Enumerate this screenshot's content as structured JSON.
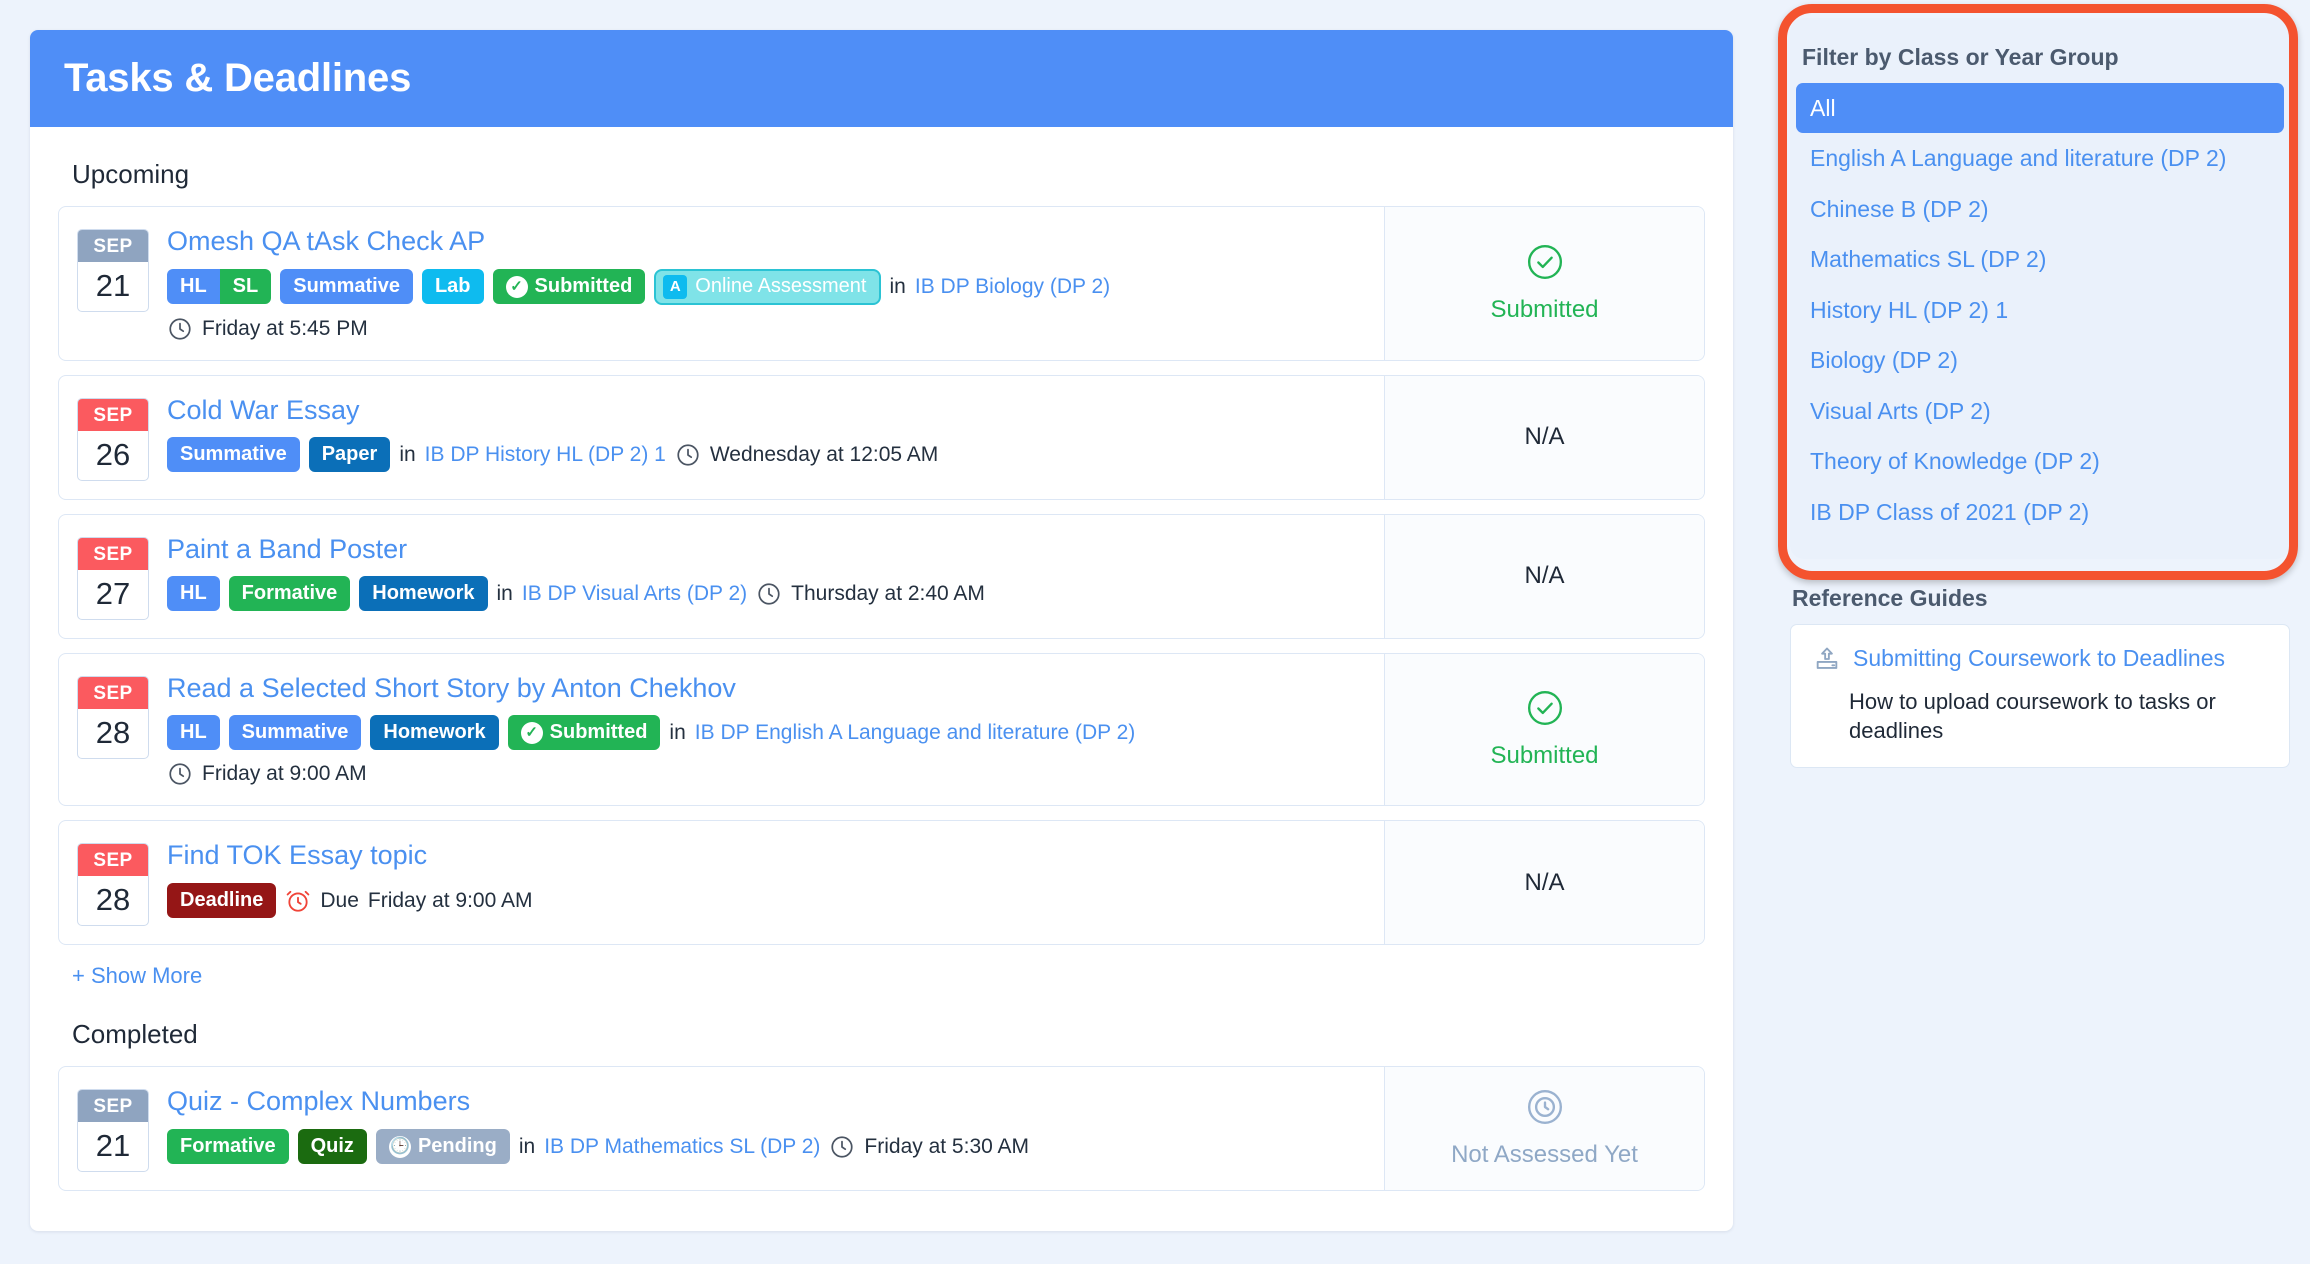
{
  "header": {
    "title": "Tasks & Deadlines"
  },
  "sections": {
    "upcoming_label": "Upcoming",
    "completed_label": "Completed",
    "show_more_label": "+ Show More"
  },
  "labels": {
    "in": "in",
    "due": "Due"
  },
  "upcoming": [
    {
      "month": "SEP",
      "day": "21",
      "date_state": "past",
      "title": "Omesh QA tAsk Check AP",
      "badges": [
        {
          "type": "split",
          "left": "HL",
          "right": "SL"
        },
        {
          "type": "solid",
          "color": "b-blue",
          "label": "Summative"
        },
        {
          "type": "solid",
          "color": "b-cyan",
          "label": "Lab"
        },
        {
          "type": "check",
          "color": "b-green",
          "label": "Submitted"
        },
        {
          "type": "online",
          "letter": "A",
          "label": "Online Assessment"
        }
      ],
      "class_name": "IB DP Biology (DP 2)",
      "time": "Friday at 5:45 PM",
      "time_on_second_row": true,
      "status": "Submitted",
      "status_kind": "submitted"
    },
    {
      "month": "SEP",
      "day": "26",
      "date_state": "due",
      "title": "Cold War Essay",
      "badges": [
        {
          "type": "solid",
          "color": "b-blue",
          "label": "Summative"
        },
        {
          "type": "solid",
          "color": "b-darkblue",
          "label": "Paper"
        }
      ],
      "class_name": "IB DP History HL (DP 2) 1",
      "time": "Wednesday at 12:05 AM",
      "time_on_second_row": false,
      "status": "N/A",
      "status_kind": "na"
    },
    {
      "month": "SEP",
      "day": "27",
      "date_state": "due",
      "title": "Paint a Band Poster",
      "badges": [
        {
          "type": "solid",
          "color": "b-blue",
          "label": "HL"
        },
        {
          "type": "solid",
          "color": "b-green",
          "label": "Formative"
        },
        {
          "type": "solid",
          "color": "b-darkblue",
          "label": "Homework"
        }
      ],
      "class_name": "IB DP Visual Arts (DP 2)",
      "time": "Thursday at 2:40 AM",
      "time_on_second_row": false,
      "status": "N/A",
      "status_kind": "na"
    },
    {
      "month": "SEP",
      "day": "28",
      "date_state": "due",
      "title": "Read a Selected Short Story by Anton Chekhov",
      "badges": [
        {
          "type": "solid",
          "color": "b-blue",
          "label": "HL"
        },
        {
          "type": "solid",
          "color": "b-blue",
          "label": "Summative"
        },
        {
          "type": "solid",
          "color": "b-darkblue",
          "label": "Homework"
        },
        {
          "type": "check",
          "color": "b-green",
          "label": "Submitted"
        }
      ],
      "class_name": "IB DP English A Language and literature (DP 2)",
      "time": "Friday at 9:00 AM",
      "time_on_second_row": true,
      "status": "Submitted",
      "status_kind": "submitted"
    },
    {
      "month": "SEP",
      "day": "28",
      "date_state": "due",
      "title": "Find TOK Essay topic",
      "badges": [
        {
          "type": "solid",
          "color": "b-maroon",
          "label": "Deadline"
        }
      ],
      "class_name": "",
      "time": "Friday at 9:00 AM",
      "deadline_style": true,
      "time_on_second_row": false,
      "status": "N/A",
      "status_kind": "na"
    }
  ],
  "completed": [
    {
      "month": "SEP",
      "day": "21",
      "date_state": "past",
      "title": "Quiz - Complex Numbers",
      "badges": [
        {
          "type": "solid",
          "color": "b-green",
          "label": "Formative"
        },
        {
          "type": "solid",
          "color": "b-darkgreen",
          "label": "Quiz"
        },
        {
          "type": "clock",
          "color": "b-gray",
          "label": "Pending"
        }
      ],
      "class_name": "IB DP Mathematics SL (DP 2)",
      "time": "Friday at 5:30 AM",
      "time_on_second_row": false,
      "status": "Not Assessed Yet",
      "status_kind": "notassessed"
    }
  ],
  "sidebar": {
    "filter_heading": "Filter by Class or Year Group",
    "filter_items": [
      {
        "label": "All",
        "active": true
      },
      {
        "label": "English A Language and literature (DP 2)",
        "active": false
      },
      {
        "label": "Chinese B (DP 2)",
        "active": false
      },
      {
        "label": "Mathematics SL (DP 2)",
        "active": false
      },
      {
        "label": "History HL (DP 2) 1",
        "active": false
      },
      {
        "label": "Biology (DP 2)",
        "active": false
      },
      {
        "label": "Visual Arts (DP 2)",
        "active": false
      },
      {
        "label": "Theory of Knowledge (DP 2)",
        "active": false
      },
      {
        "label": "IB DP Class of 2021 (DP 2)",
        "active": false
      }
    ],
    "reference_heading": "Reference Guides",
    "reference_items": [
      {
        "link": "Submitting Coursework to Deadlines",
        "desc": "How to upload coursework to tasks or deadlines"
      }
    ]
  },
  "colors": {
    "accent_blue": "#4f8ef7",
    "link_blue": "#4a90f0",
    "green": "#22b455",
    "red": "#fb5a5f",
    "maroon": "#951616",
    "highlight_ring": "#f4532f",
    "page_bg": "#edf3fc"
  }
}
